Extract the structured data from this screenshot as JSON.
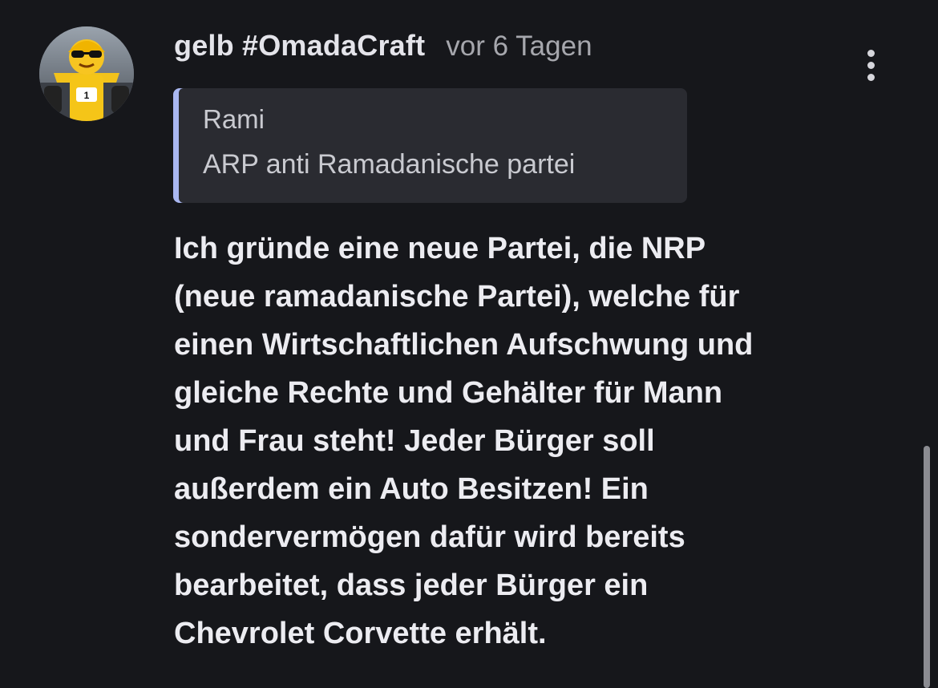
{
  "comment": {
    "author": "gelb #OmadaCraft",
    "time": "vor 6 Tagen",
    "avatar_icon": "racing-car-emoji-avatar",
    "menu_icon": "more-vertical-icon",
    "quote": {
      "author": "Rami",
      "text": "ARP anti Ramadanische partei",
      "accent_color": "#a9b7f1"
    },
    "body_lines": [
      "Ich gründe eine neue Partei, die NRP",
      "(neue ramadanische Partei), welche für",
      "einen Wirtschaftlichen Aufschwung und",
      "gleiche Rechte und Gehälter für Mann",
      "und Frau steht! Jeder Bürger soll",
      "außerdem ein Auto Besitzen! Ein",
      "sondervermögen dafür wird bereits",
      "bearbeitet, dass jeder Bürger ein",
      "Chevrolet Corvette erhält."
    ]
  },
  "colors": {
    "background": "#16171b",
    "quote_background": "#2a2b31"
  }
}
